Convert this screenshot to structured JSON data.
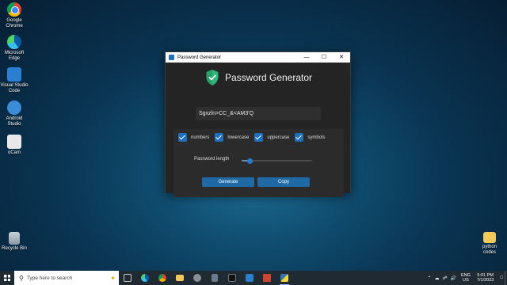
{
  "desktop": {
    "icons": [
      {
        "label": "Google\nChrome"
      },
      {
        "label": "Microsoft\nEdge"
      },
      {
        "label": "Visual Studio\nCode"
      },
      {
        "label": "Android\nStudio"
      },
      {
        "label": "oCam"
      },
      {
        "label": "Recycle Bin"
      },
      {
        "label": "python\ncodes"
      }
    ]
  },
  "window": {
    "title": "Password Generator",
    "controls": {
      "minimize": "—",
      "maximize": "☐",
      "close": "✕"
    }
  },
  "app": {
    "heading": "Password Generator",
    "password_value": "Sgxzln>CC_&<AM3'Q",
    "options": [
      {
        "label": "numbers",
        "checked": true
      },
      {
        "label": "lowercase",
        "checked": true
      },
      {
        "label": "uppercase",
        "checked": true
      },
      {
        "label": "symbols",
        "checked": true
      }
    ],
    "length_label": "Password length",
    "length_level": 0.12,
    "generate_label": "Generate",
    "copy_label": "Copy",
    "accent_color": "#1f6aa5",
    "shield_color": "#2fb67a"
  },
  "taskbar": {
    "search_placeholder": "Type here to search",
    "apps": [
      "task-view",
      "edge",
      "chrome",
      "file-explorer",
      "camera",
      "calculator",
      "terminal",
      "vscode",
      "file-manager",
      "python"
    ],
    "language_line1": "ENG",
    "language_line2": "US",
    "time": "5:01 PM",
    "date": "7/1/2023"
  }
}
